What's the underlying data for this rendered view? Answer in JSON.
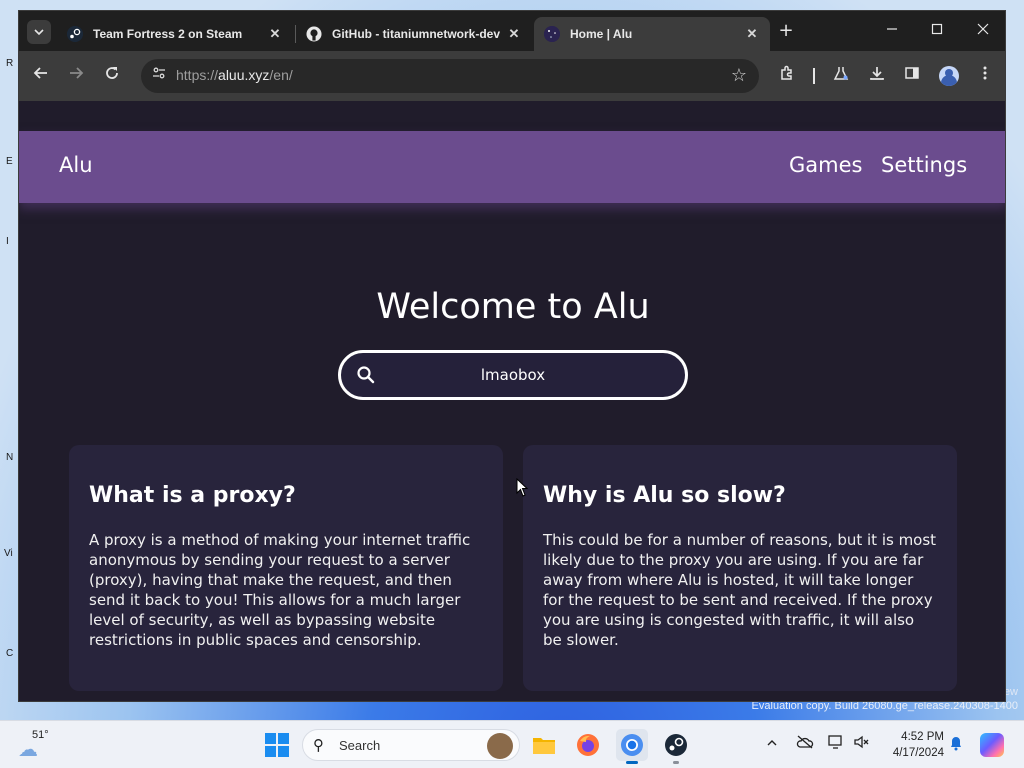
{
  "desktop": {
    "icon_fragments": [
      "R",
      "E",
      "I",
      "N",
      "Vi",
      "C"
    ],
    "watermark": {
      "line1": "ew",
      "line2": "Evaluation copy. Build 26080.ge_release.240308-1400"
    }
  },
  "browser": {
    "tabs": [
      {
        "label": "Team Fortress 2 on Steam",
        "favicon": "steam-icon",
        "active": false
      },
      {
        "label": "GitHub - titaniumnetwork-dev",
        "favicon": "github-icon",
        "active": false
      },
      {
        "label": "Home | Alu",
        "favicon": "alu-icon",
        "active": true
      }
    ],
    "tab_close": "✕",
    "new_tab": "+",
    "url_scheme": "https://",
    "url_host": "aluu.xyz",
    "url_path": "/en/"
  },
  "site": {
    "logo": "Alu",
    "nav_games": "Games",
    "nav_settings": "Settings",
    "heading": "Welcome to Alu",
    "search_value": "lmaobox",
    "cards": [
      {
        "title": "What is a proxy?",
        "body": "A proxy is a method of making your internet traffic anonymous by sending your request to a server (proxy), having that make the request, and then send it back to you! This allows for a much larger level of security, as well as bypassing website restrictions in public spaces and censorship."
      },
      {
        "title": "Why is Alu so slow?",
        "body": "This could be for a number of reasons, but it is most likely due to the proxy you are using. If you are far away from where Alu is hosted, it will take longer for the request to be sent and received. If the proxy you are using is congested with traffic, it will also be slower."
      }
    ]
  },
  "taskbar": {
    "temperature": "51°",
    "search_placeholder": "Search",
    "time": "4:52 PM",
    "date": "4/17/2024"
  },
  "colors": {
    "nav_bg": "#6b4c8e",
    "page_bg": "#201c2b",
    "card_bg": "#28243c"
  }
}
